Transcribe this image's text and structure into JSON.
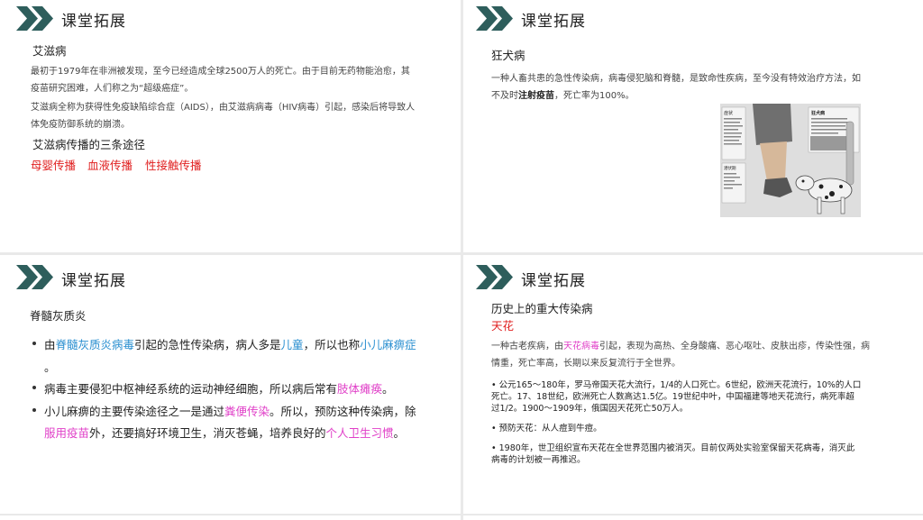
{
  "slide_title": "课堂拓展",
  "s1": {
    "heading": "艾滋病",
    "p1_line1": "最初于1979年在非洲被发现，至今已经造成全球2500万人的死亡。由于目前无药物能治愈，其",
    "p1_line2": "疫苗研究困难，人们称之为“超级癌症”。",
    "p2_line1": "艾滋病全称为获得性免疫缺陷综合症（AIDS），由艾滋病病毒（HIV病毒）引起，感染后将导致人",
    "p2_line2": "体免疫防御系统的崩溃。",
    "routes_heading": "艾滋病传播的三条途径",
    "routes": [
      "母婴传播",
      "血液传播",
      "性接触传播"
    ]
  },
  "s2": {
    "heading": "狂犬病",
    "line1": "一种人畜共患的急性传染病，病毒侵犯脑和脊髓，是致命性疾病，至今没有特效治疗方法，如",
    "line2_pre": "不及时",
    "line2_bold": "注射疫苗",
    "line2_post": "，死亡率为100%。",
    "illus_label_right": "狂犬病",
    "illus_label_left": "症状",
    "illus_label_bottom": "潜伏期"
  },
  "s3": {
    "heading": "脊髓灰质炎",
    "b1_pre": "由",
    "b1_blue1": "脊髓灰质炎病毒",
    "b1_mid": "引起的急性传染病，病人多是",
    "b1_blue2": "儿童",
    "b1_mid2": "，所以也称",
    "b1_blue3": "小儿麻痹症",
    "b1_end": "。",
    "b2_pre": "病毒主要侵犯中枢神经系统的运动神经细胞，所以病后常有",
    "b2_pink": "肢体瘫痪",
    "b2_end": "。",
    "b3_pre": "小儿麻痹的主要传染途径之一是通过",
    "b3_pink1": "粪便传染",
    "b3_mid": "。所以，预防这种传染病，除",
    "b3_pink2": "服用疫苗",
    "b3_mid2": "外，还要搞好环境卫生，消灭苍蝇，培养良好的",
    "b3_pink3": "个人卫生习惯",
    "b3_end": "。"
  },
  "s4": {
    "heading": "历史上的重大传染病",
    "sub": "天花",
    "d1_pre": "一种古老疾病，由",
    "d1_pink": "天花病毒",
    "d1_post": "引起，表现为高热、全身酸痛、恶心呕吐、皮肤出疹，传染性强，病",
    "d2": "情重，死亡率高，长期以来反复流行于全世界。",
    "b1_l1": "• 公元165～180年，罗马帝国天花大流行，1/4的人口死亡。6世纪，欧洲天花流行，10%的人口",
    "b1_l2": "死亡。17、18世纪，欧洲死亡人数高达1.5亿。19世纪中叶，中国福建等地天花流行，病死率超",
    "b1_l3": "过1/2。1900～1909年，俄国因天花死亡50万人。",
    "b2": "• 预防天花：从人痘到牛痘。",
    "b3_l1": "• 1980年，世卫组织宣布天花在全世界范围内被消灭。目前仅两处实验室保留天花病毒，消灭此",
    "b3_l2": "病毒的计划被一再推迟。"
  },
  "colors": {
    "accent": "#2e5e5c",
    "red": "#e02020",
    "blue": "#2a8fd0",
    "pink": "#e040c8"
  },
  "icons": {
    "title_mark": "double-chevron-icon"
  }
}
